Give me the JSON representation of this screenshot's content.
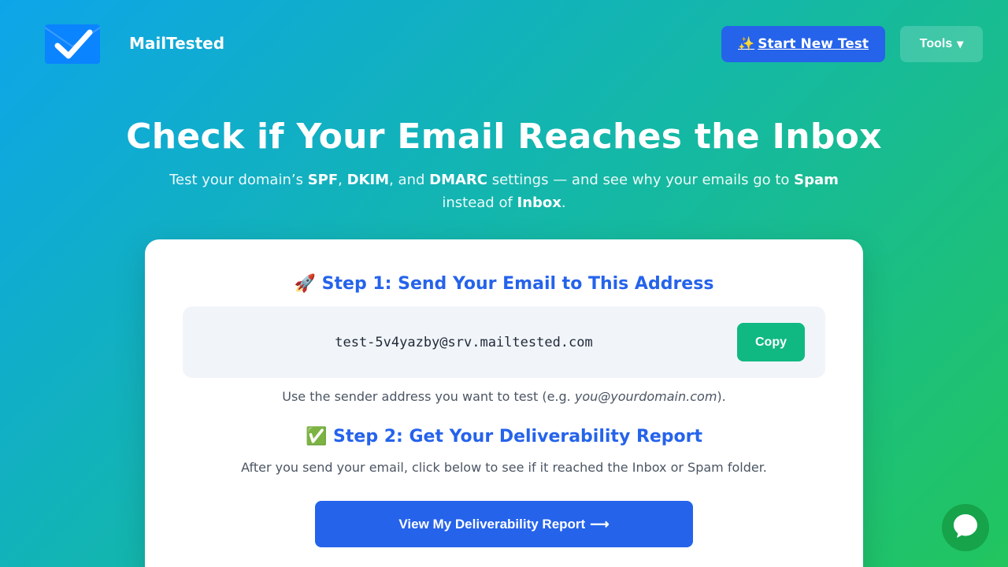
{
  "header": {
    "brand": "MailTested",
    "start_button": "Start New Test",
    "start_button_icon": "sparkles-icon",
    "tools_button": "Tools",
    "tools_caret": "▾"
  },
  "hero": {
    "title": "Check if Your Email Reaches the Inbox",
    "sub": {
      "t1": "Test your domain’s ",
      "spf": "SPF",
      "t2": ", ",
      "dkim": "DKIM",
      "t3": ", and ",
      "dmarc": "DMARC",
      "t4": " settings — and see why your emails go to ",
      "spam": "Spam",
      "t5": " instead of ",
      "inbox": "Inbox",
      "t6": "."
    }
  },
  "card": {
    "step1": {
      "emoji": "🚀",
      "title": "Step 1: Send Your Email to This Address",
      "address": "test-5v4yazby@srv.mailtested.com",
      "copy_button": "Copy",
      "hint_pre": "Use the sender address you want to test (e.g. ",
      "hint_example": "you@yourdomain.com",
      "hint_post": ")."
    },
    "step2": {
      "emoji": "✅",
      "title": "Step 2: Get Your Deliverability Report",
      "hint": "After you send your email, click below to see if it reached the Inbox or Spam folder.",
      "report_button": "View My Deliverability Report",
      "report_arrow": "⟶"
    }
  },
  "colors": {
    "accent_blue": "#2563eb",
    "accent_green": "#10b981",
    "chat_green": "#16a34a"
  }
}
